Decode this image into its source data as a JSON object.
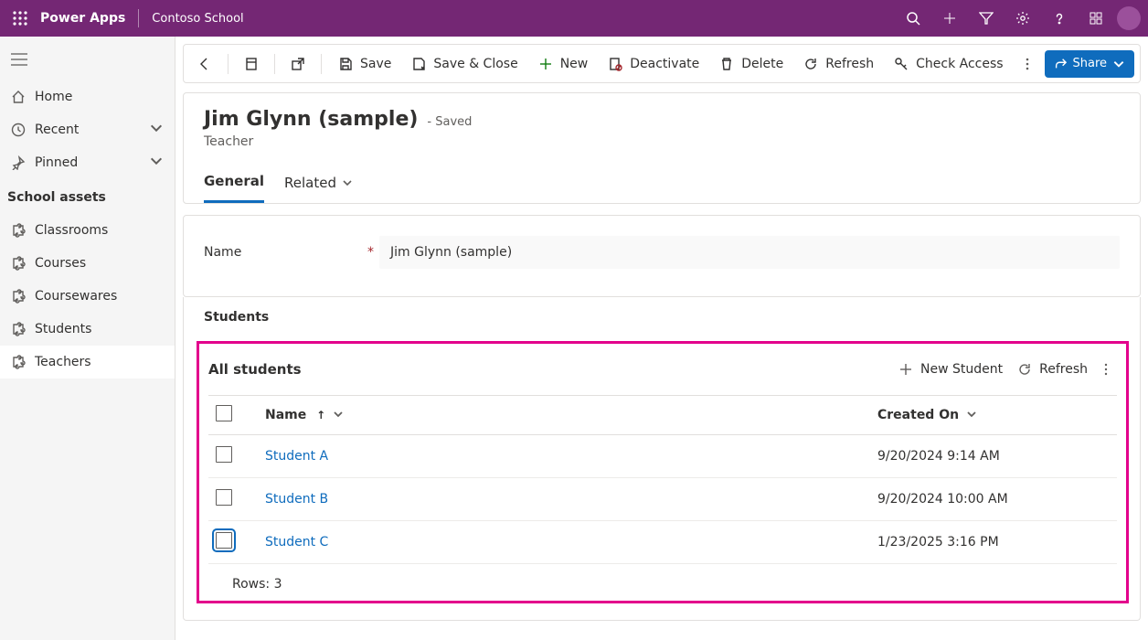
{
  "header": {
    "brand": "Power Apps",
    "environment": "Contoso School"
  },
  "nav": {
    "items_top": [
      {
        "label": "Home",
        "icon": "home"
      },
      {
        "label": "Recent",
        "icon": "clock",
        "chevron": true
      },
      {
        "label": "Pinned",
        "icon": "pin",
        "chevron": true
      }
    ],
    "section_title": "School assets",
    "items_assets": [
      {
        "label": "Classrooms"
      },
      {
        "label": "Courses"
      },
      {
        "label": "Coursewares"
      },
      {
        "label": "Students"
      },
      {
        "label": "Teachers"
      }
    ],
    "active_asset_index": 4
  },
  "commandbar": {
    "save": "Save",
    "save_close": "Save & Close",
    "new": "New",
    "deactivate": "Deactivate",
    "delete": "Delete",
    "refresh": "Refresh",
    "check_access": "Check Access",
    "share": "Share"
  },
  "record": {
    "title": "Jim Glynn (sample)",
    "status": "- Saved",
    "entity": "Teacher",
    "tabs": {
      "general": "General",
      "related": "Related"
    },
    "name_field": {
      "label": "Name",
      "value": "Jim Glynn (sample)"
    }
  },
  "subgrid": {
    "heading": "Students",
    "view_name": "All students",
    "new_button": "New Student",
    "refresh_button": "Refresh",
    "columns": {
      "name": "Name",
      "created_on": "Created On"
    },
    "rows": [
      {
        "name": "Student A",
        "created_on": "9/20/2024 9:14 AM"
      },
      {
        "name": "Student B",
        "created_on": "9/20/2024 10:00 AM"
      },
      {
        "name": "Student C",
        "created_on": "1/23/2025 3:16 PM"
      }
    ],
    "rows_label": "Rows:",
    "rows_count": "3"
  }
}
